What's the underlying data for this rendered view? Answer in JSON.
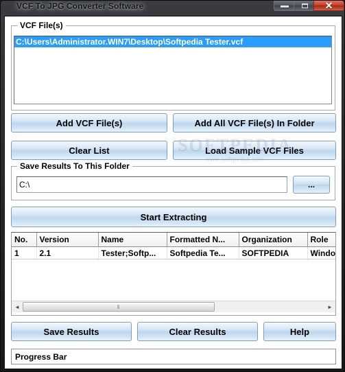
{
  "window": {
    "title": "VCF To JPG Converter Software",
    "controls": {
      "minimize": "—",
      "maximize": "□",
      "close": "✕"
    }
  },
  "vcf_files_group": {
    "label": "VCF File(s)",
    "items": [
      {
        "path": "C:\\Users\\Administrator.WIN7\\Desktop\\Softpedia Tester.vcf",
        "selected": true
      }
    ]
  },
  "actions": {
    "add_vcf_files": "Add VCF File(s)",
    "add_all_vcf_files_in_folder": "Add All VCF File(s) In Folder",
    "clear_list": "Clear List",
    "load_sample_vcf_files": "Load Sample VCF Files"
  },
  "save_folder_group": {
    "label": "Save Results To This Folder",
    "path_value": "C:\\",
    "path_placeholder": "",
    "browse_label": "..."
  },
  "start": {
    "label": "Start Extracting"
  },
  "results_table": {
    "columns": [
      "No.",
      "Version",
      "Name",
      "Formatted N...",
      "Organization",
      "Role"
    ],
    "rows": [
      [
        "1",
        "2.1",
        "Tester;Softp...",
        "Softpedia Te...",
        "SOFTPEDIA",
        "Windows"
      ]
    ],
    "scroll": {
      "left_arrow": "◄",
      "right_arrow": "►",
      "grip": "‖"
    }
  },
  "footer": {
    "save_results": "Save Results",
    "clear_results": "Clear Results",
    "help": "Help"
  },
  "progress": {
    "label": "Progress Bar"
  },
  "watermark": {
    "main": "SOFTPEDIA",
    "sub": "www.softpedia.com"
  },
  "colors": {
    "selection_blue": "#2a9dfc",
    "button_face": "#cfe3f4",
    "title_bar": "#2a2c30",
    "close_red": "#c43f28"
  }
}
